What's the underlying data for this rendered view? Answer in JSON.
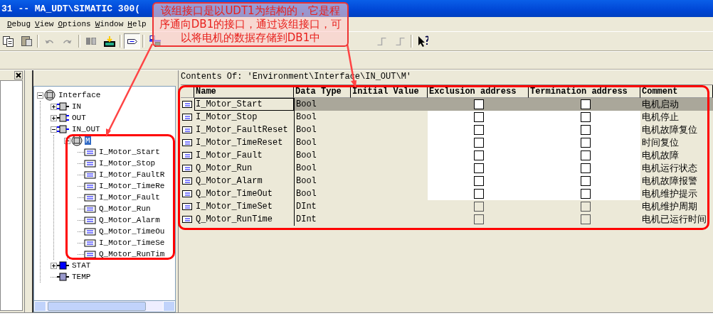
{
  "window": {
    "title": "31 -- MA_UDT\\SIMATIC 300("
  },
  "menu": [
    {
      "label": "Debug"
    },
    {
      "label": "View"
    },
    {
      "label": "Options"
    },
    {
      "label": "Window"
    },
    {
      "label": "Help"
    }
  ],
  "toolbar": {
    "left": [
      {
        "kind": "copy",
        "pressed": false
      },
      {
        "kind": "paste",
        "pressed": false
      },
      {
        "kind": "sep"
      },
      {
        "kind": "undo",
        "pressed": false
      },
      {
        "kind": "redo",
        "pressed": false
      },
      {
        "kind": "sep"
      },
      {
        "kind": "compile",
        "pressed": false
      },
      {
        "kind": "download",
        "pressed": false
      },
      {
        "kind": "sep"
      },
      {
        "kind": "element",
        "pressed": true
      },
      {
        "kind": "sep"
      },
      {
        "kind": "network",
        "pressed": false
      }
    ],
    "right": [
      {
        "kind": "step",
        "pressed": false
      },
      {
        "kind": "step",
        "pressed": false
      },
      {
        "kind": "sep"
      },
      {
        "kind": "help",
        "pressed": false
      }
    ]
  },
  "tree": {
    "label": "Interface",
    "kind": "interface",
    "expanded": true,
    "selected": false,
    "children": [
      {
        "label": "IN",
        "kind": "in",
        "expanded": false,
        "selected": false
      },
      {
        "label": "OUT",
        "kind": "out",
        "expanded": false,
        "selected": false
      },
      {
        "label": "IN_OUT",
        "kind": "inout",
        "expanded": true,
        "selected": false,
        "children": [
          {
            "label": "M",
            "kind": "struct",
            "expanded": true,
            "selected": true,
            "children": [
              {
                "label": "I_Motor_Start",
                "kind": "element",
                "selected": false
              },
              {
                "label": "I_Motor_Stop",
                "kind": "element",
                "selected": false
              },
              {
                "label": "I_Motor_FaultR",
                "kind": "element",
                "selected": false
              },
              {
                "label": "I_Motor_TimeRe",
                "kind": "element",
                "selected": false
              },
              {
                "label": "I_Motor_Fault",
                "kind": "element",
                "selected": false
              },
              {
                "label": "Q_Motor_Run",
                "kind": "element",
                "selected": false
              },
              {
                "label": "Q_Motor_Alarm",
                "kind": "element",
                "selected": false
              },
              {
                "label": "Q_Motor_TimeOu",
                "kind": "element",
                "selected": false
              },
              {
                "label": "I_Motor_TimeSe",
                "kind": "element",
                "selected": false
              },
              {
                "label": "Q_Motor_RunTim",
                "kind": "element",
                "selected": false
              }
            ]
          }
        ]
      },
      {
        "label": "STAT",
        "kind": "stat",
        "expanded": false,
        "selected": false
      },
      {
        "label": "TEMP",
        "kind": "temp",
        "selected": false
      }
    ]
  },
  "contents_path": "Contents Of: 'Environment\\Interface\\IN_OUT\\M'",
  "table": {
    "columns": [
      "Name",
      "Data Type",
      "Initial Value",
      "Exclusion address",
      "Termination address",
      "Comment"
    ],
    "rows": [
      {
        "name": "I_Motor_Start",
        "data_type": "Bool",
        "exclusion_checked": false,
        "termination_checked": false,
        "comment": "电机启动",
        "selected": true,
        "disabled": false
      },
      {
        "name": "I_Motor_Stop",
        "data_type": "Bool",
        "exclusion_checked": false,
        "termination_checked": false,
        "comment": "电机停止",
        "selected": false,
        "disabled": false
      },
      {
        "name": "I_Motor_FaultReset",
        "data_type": "Bool",
        "exclusion_checked": false,
        "termination_checked": false,
        "comment": "电机故障复位",
        "selected": false,
        "disabled": false
      },
      {
        "name": "I_Motor_TimeReset",
        "data_type": "Bool",
        "exclusion_checked": false,
        "termination_checked": false,
        "comment": "时间复位",
        "selected": false,
        "disabled": false
      },
      {
        "name": "I_Motor_Fault",
        "data_type": "Bool",
        "exclusion_checked": false,
        "termination_checked": false,
        "comment": "电机故障",
        "selected": false,
        "disabled": false
      },
      {
        "name": "Q_Motor_Run",
        "data_type": "Bool",
        "exclusion_checked": false,
        "termination_checked": false,
        "comment": "电机运行状态",
        "selected": false,
        "disabled": false
      },
      {
        "name": "Q_Motor_Alarm",
        "data_type": "Bool",
        "exclusion_checked": false,
        "termination_checked": false,
        "comment": "电机故障报警",
        "selected": false,
        "disabled": false
      },
      {
        "name": "Q_Motor_TimeOut",
        "data_type": "Bool",
        "exclusion_checked": false,
        "termination_checked": false,
        "comment": "电机维护提示",
        "selected": false,
        "disabled": false
      },
      {
        "name": "I_Motor_TimeSet",
        "data_type": "DInt",
        "exclusion_checked": false,
        "termination_checked": false,
        "comment": "电机维护周期",
        "selected": false,
        "disabled": true
      },
      {
        "name": "Q_Motor_RunTime",
        "data_type": "DInt",
        "exclusion_checked": false,
        "termination_checked": false,
        "comment": "电机已运行时间",
        "selected": false,
        "disabled": true
      }
    ]
  },
  "callout": {
    "text": "该组接口是以UDT1为结构的，它是程序通向DB1的接口，通过该组接口，可以将电机的数据存储到DB1中"
  }
}
